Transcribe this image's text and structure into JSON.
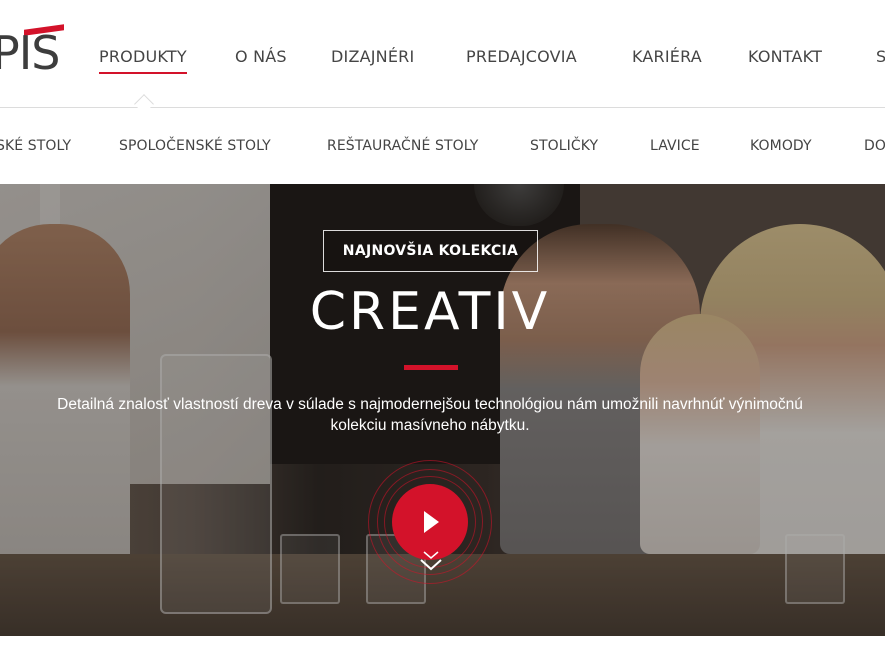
{
  "brand": {
    "logo_text": "PIS",
    "accent_color": "#d3122a"
  },
  "nav": {
    "items": [
      {
        "label": "PRODUKTY",
        "active": true
      },
      {
        "label": "O NÁS"
      },
      {
        "label": "DIZAJNÉRI"
      },
      {
        "label": "PREDAJCOVIA"
      },
      {
        "label": "KARIÉRA"
      },
      {
        "label": "KONTAKT"
      },
      {
        "label": "S"
      }
    ]
  },
  "subnav": {
    "items": [
      {
        "label": "SKÉ STOLY"
      },
      {
        "label": "SPOLOČENSKÉ STOLY"
      },
      {
        "label": "REŠTAURAČNÉ STOLY"
      },
      {
        "label": "STOLIČKY"
      },
      {
        "label": "LAVICE"
      },
      {
        "label": "KOMODY"
      },
      {
        "label": "DO"
      }
    ]
  },
  "hero": {
    "badge": "NAJNOVŠIA KOLEKCIA",
    "title": "CREATIV",
    "description": "Detailná znalosť vlastností dreva v súlade s najmodernejšou technológiou nám umožnili navrhnúť výnimočnú kolekciu masívneho nábytku.",
    "play_icon": "play-icon",
    "scroll_icon": "chevron-down-icon"
  }
}
